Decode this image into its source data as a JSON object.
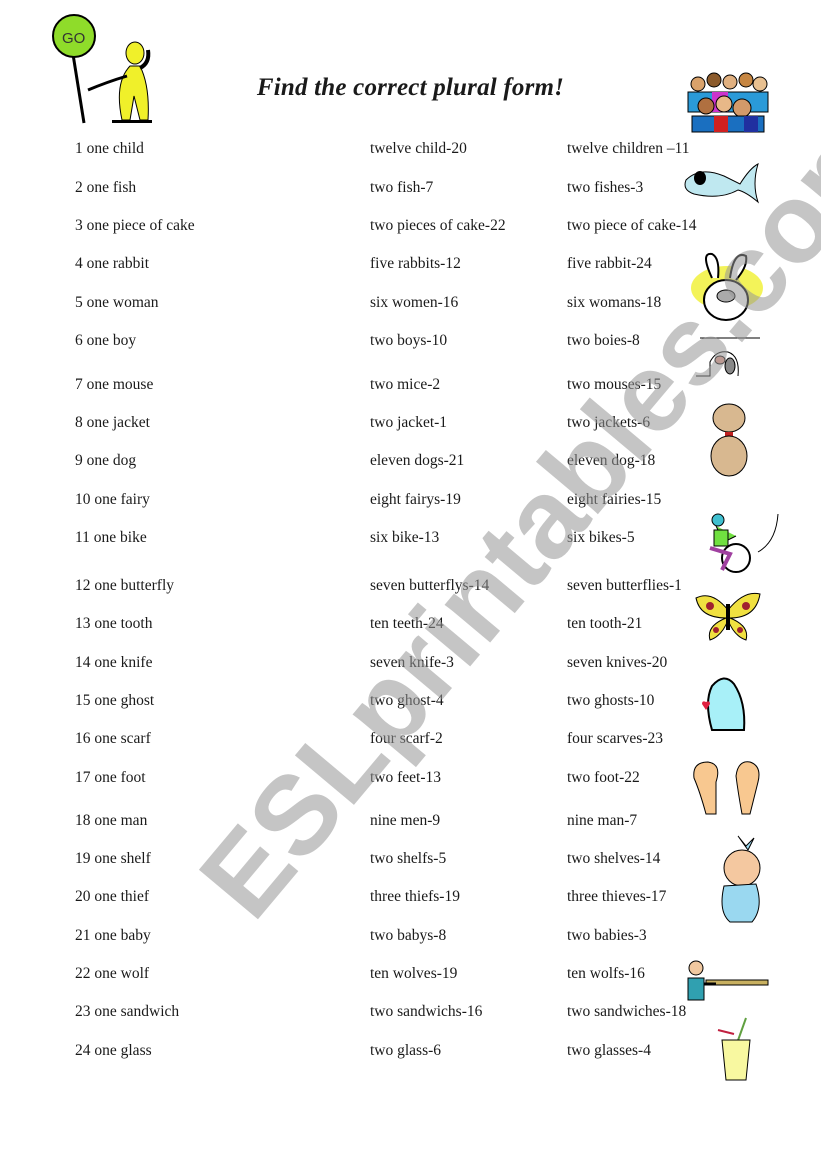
{
  "title": "Find the correct plural form!",
  "watermark": "ESLprintables.com",
  "rows": [
    {
      "singular": "1 one child",
      "option_a": "twelve child-20",
      "option_b": "twelve children –11"
    },
    {
      "singular": "2 one fish",
      "option_a": "two fish-7",
      "option_b": "two fishes-3"
    },
    {
      "singular": "3 one piece of cake",
      "option_a": "two pieces of cake-22",
      "option_b": "two piece of cake-14"
    },
    {
      "singular": "4 one rabbit",
      "option_a": "five rabbits-12",
      "option_b": "five rabbit-24"
    },
    {
      "singular": "5 one woman",
      "option_a": "six women-16",
      "option_b": "six womans-18"
    },
    {
      "singular": "6 one boy",
      "option_a": "two boys-10",
      "option_b": "two boies-8"
    },
    {
      "singular": "7 one mouse",
      "option_a": "two mice-2",
      "option_b": "two mouses-15"
    },
    {
      "singular": "8 one jacket",
      "option_a": "two jacket-1",
      "option_b": "two jackets-6"
    },
    {
      "singular": "9 one dog",
      "option_a": "eleven dogs-21",
      "option_b": "eleven dog-18"
    },
    {
      "singular": "10 one fairy",
      "option_a": "eight fairys-19",
      "option_b": "eight fairies-15"
    },
    {
      "singular": "11 one bike",
      "option_a": "six bike-13",
      "option_b": "six bikes-5"
    },
    {
      "singular": "12 one butterfly",
      "option_a": "seven butterflys-14",
      "option_b": "seven butterflies-1"
    },
    {
      "singular": "13 one tooth",
      "option_a": "ten teeth-24",
      "option_b": "ten tooth-21"
    },
    {
      "singular": "14 one knife",
      "option_a": "seven knife-3",
      "option_b": "seven knives-20"
    },
    {
      "singular": "15 one ghost",
      "option_a": "two ghost-4",
      "option_b": "two ghosts-10"
    },
    {
      "singular": "16 one scarf",
      "option_a": "four scarf-2",
      "option_b": "four scarves-23"
    },
    {
      "singular": "17 one foot",
      "option_a": "two feet-13",
      "option_b": "two foot-22"
    },
    {
      "singular": "18 one man",
      "option_a": "nine men-9",
      "option_b": "nine man-7"
    },
    {
      "singular": "19 one shelf",
      "option_a": "two shelfs-5",
      "option_b": "two shelves-14"
    },
    {
      "singular": "20 one thief",
      "option_a": "three thiefs-19",
      "option_b": "three thieves-17"
    },
    {
      "singular": "21 one baby",
      "option_a": "two babys-8",
      "option_b": "two babies-3"
    },
    {
      "singular": "22 one wolf",
      "option_a": "ten wolves-19",
      "option_b": "ten wolfs-16"
    },
    {
      "singular": "23 one sandwich",
      "option_a": "two sandwichs-16",
      "option_b": "two sandwiches-18"
    },
    {
      "singular": "24 one glass",
      "option_a": "two glass-6",
      "option_b": "two glasses-4"
    }
  ],
  "clipart": {
    "go_sign_text": "GO",
    "images": [
      "go-sign-man",
      "crowd-of-people",
      "fish",
      "rabbit",
      "mouse",
      "dog",
      "cyclist",
      "butterfly",
      "ghost",
      "feet",
      "baby",
      "waiter-with-tray",
      "milkshake-glass"
    ]
  },
  "colors": {
    "text": "#1a1a1a",
    "go_sign": "#8fdc2a",
    "figure_yellow": "#f0f02a",
    "watermark": "#969696"
  }
}
